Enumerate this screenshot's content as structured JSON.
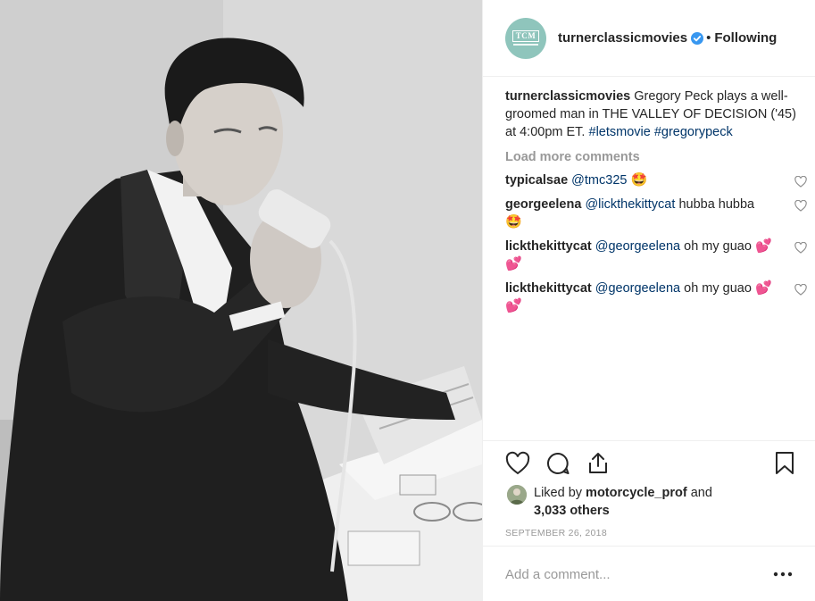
{
  "post": {
    "username": "turnerclassicmovies",
    "avatar_logo": "TCM",
    "follow_state": "Following",
    "dot": "•",
    "icons": {
      "verified": "verified-badge-icon",
      "like": "heart-outline-icon",
      "comment": "comment-bubble-icon",
      "share": "share-upload-icon",
      "save": "bookmark-icon",
      "more": "ellipsis-icon"
    },
    "colors": {
      "verified_blue": "#3897f0",
      "link": "#003569",
      "muted": "#999999",
      "text": "#262626",
      "avatar_bg": "#8fc5bc"
    }
  },
  "caption": {
    "username": "turnerclassicmovies",
    "text": "Gregory Peck plays a well-groomed man in THE VALLEY OF DECISION ('45) at 4:00pm ET.",
    "hashtag1": "#letsmovie",
    "hashtag2": "#gregorypeck"
  },
  "load_more": "Load more comments",
  "comments": [
    {
      "user": "typicalsae",
      "mention": "@tmc325",
      "text": "",
      "emoji": "🤩"
    },
    {
      "user": "georgeelena",
      "mention": "@lickthekittycat",
      "text": "hubba hubba",
      "emoji": "🤩"
    },
    {
      "user": "lickthekittycat",
      "mention": "@georgeelena",
      "text": "oh my guao",
      "emoji": "💕💕"
    },
    {
      "user": "lickthekittycat",
      "mention": "@georgeelena",
      "text": "oh my guao",
      "emoji": "💕💕"
    }
  ],
  "likes": {
    "prefix": "Liked by",
    "user": "motorcycle_prof",
    "and": "and",
    "others": "3,033 others"
  },
  "date": "SEPTEMBER 26, 2018",
  "add_comment_placeholder": "Add a comment..."
}
